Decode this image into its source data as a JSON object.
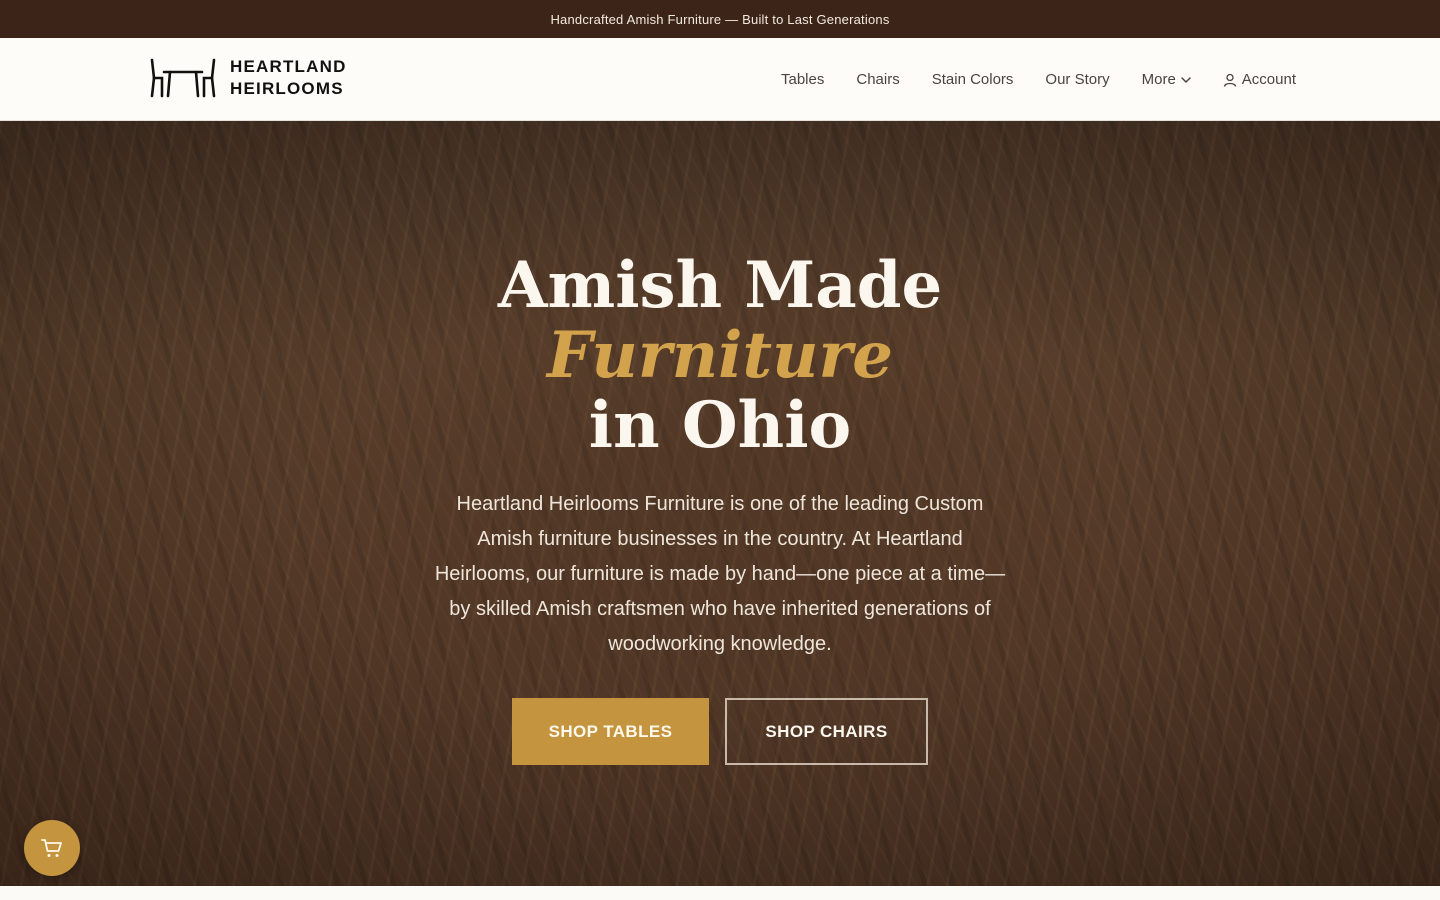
{
  "announcement": "Handcrafted Amish Furniture — Built to Last Generations",
  "logo": {
    "line1": "HEARTLAND",
    "line2": "HEIRLOOMS",
    "icon": "table-chairs-icon"
  },
  "nav": {
    "tables": "Tables",
    "chairs": "Chairs",
    "stain_colors": "Stain Colors",
    "our_story": "Our Story",
    "more": "More",
    "account": "Account"
  },
  "hero": {
    "title_line1": "Amish Made",
    "title_accent": "Furniture",
    "title_line3": "in Ohio",
    "description": "Heartland Heirlooms Furniture is one of the leading Custom Amish furniture businesses in the country. At Heartland Heirlooms, our furniture is made by hand—one piece at a time—by skilled Amish craftsmen who have inherited generations of woodworking knowledge.",
    "primary_button": "SHOP TABLES",
    "secondary_button": "SHOP CHAIRS"
  },
  "cart": {
    "icon": "cart-icon"
  },
  "colors": {
    "announcement_bg": "#3c2418",
    "accent_gold": "#c5943f",
    "title_accent": "#d2a24c",
    "hero_bg": "#4f3726"
  }
}
